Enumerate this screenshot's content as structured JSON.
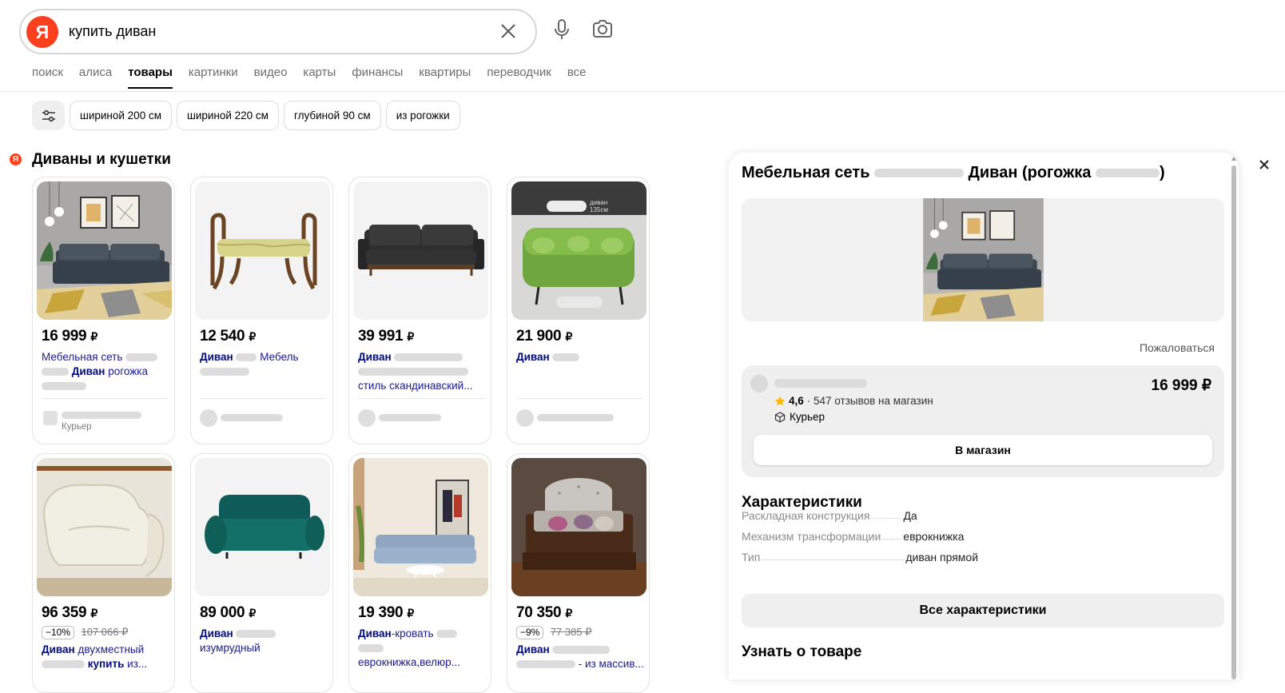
{
  "search": {
    "query": "купить диван",
    "logo_letter": "Я"
  },
  "tabs": [
    {
      "label": "поиск",
      "active": false
    },
    {
      "label": "алиса",
      "active": false
    },
    {
      "label": "товары",
      "active": true
    },
    {
      "label": "картинки",
      "active": false
    },
    {
      "label": "видео",
      "active": false
    },
    {
      "label": "карты",
      "active": false
    },
    {
      "label": "финансы",
      "active": false
    },
    {
      "label": "квартиры",
      "active": false
    },
    {
      "label": "переводчик",
      "active": false
    },
    {
      "label": "все",
      "active": false
    }
  ],
  "chips": [
    "шириной 200 см",
    "шириной 220 см",
    "глубиной 90 см",
    "из рогожки"
  ],
  "section": {
    "title": "Диваны и кушетки",
    "mini_logo": "Я"
  },
  "currency": "₽",
  "products": [
    {
      "price": "16 999",
      "title_a": "Мебельная сеть",
      "title_b": "Диван",
      "title_c": "рогожка",
      "delivery": "Курьер"
    },
    {
      "price": "12 540",
      "title_a": "Диван",
      "title_b": "Мебель"
    },
    {
      "price": "39 991",
      "title_a": "Диван",
      "title_b": "стиль скандинавский..."
    },
    {
      "price": "21 900",
      "title_a": "Диван",
      "img_text_1": "диван",
      "img_text_2": "135см"
    },
    {
      "price": "96 359",
      "discount": "−10%",
      "old_price": "107 066 ₽",
      "title_a": "Диван",
      "title_b": "двухместный",
      "title_c": "купить",
      "title_d": "из..."
    },
    {
      "price": "89 000",
      "title_a": "Диван",
      "title_b": "изумрудный"
    },
    {
      "price": "19 390",
      "title_a": "Диван",
      "title_b": "-кровать",
      "title_c": "еврокнижка,велюр..."
    },
    {
      "price": "70 350",
      "discount": "−9%",
      "old_price": "77 385 ₽",
      "title_a": "Диван",
      "title_b": "- из массив..."
    }
  ],
  "panel": {
    "title_a": "Мебельная сеть",
    "title_b": "Диван (рогожка",
    "title_c": ")",
    "complain": "Пожаловаться",
    "offer": {
      "price": "16 999 ₽",
      "rating": "4,6",
      "reviews": "· 547 отзывов на магазин",
      "delivery": "Курьер",
      "button": "В магазин"
    },
    "characteristics_title": "Характеристики",
    "characteristics": [
      {
        "key": "Раскладная конструкция",
        "value": "Да"
      },
      {
        "key": "Механизм трансформации",
        "value": "еврокнижка"
      },
      {
        "key": "Тип",
        "value": "диван прямой"
      }
    ],
    "all_characteristics": "Все характеристики",
    "learn_title": "Узнать о товаре"
  },
  "colors": {
    "brand": "#fc3f1d",
    "link": "#1a1a8f",
    "star": "#ffb800"
  }
}
